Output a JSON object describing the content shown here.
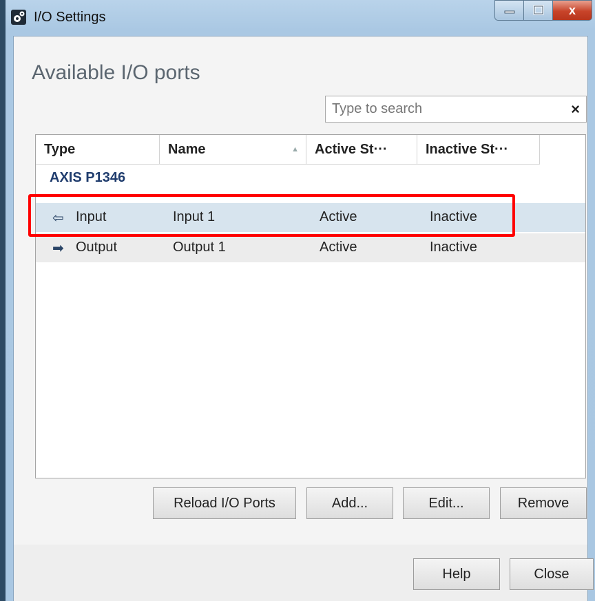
{
  "window": {
    "title": "I/O Settings"
  },
  "dialog": {
    "heading": "Available I/O ports"
  },
  "search": {
    "placeholder": "Type to search",
    "clear_icon": "×"
  },
  "table": {
    "columns": [
      "Type",
      "Name",
      "Active St···",
      "Inactive St···"
    ],
    "sorted_column": "Name",
    "group": "AXIS P1346",
    "rows": [
      {
        "icon": "input-arrow-icon",
        "icon_glyph": "⇦",
        "type": "Input",
        "name": "Input 1",
        "active": "Active",
        "inactive": "Inactive",
        "selected": true
      },
      {
        "icon": "output-arrow-icon",
        "icon_glyph": "➡",
        "type": "Output",
        "name": "Output 1",
        "active": "Active",
        "inactive": "Inactive",
        "selected": false
      }
    ]
  },
  "buttons": {
    "reload": "Reload I/O Ports",
    "add": "Add...",
    "edit": "Edit...",
    "remove": "Remove"
  },
  "footer": {
    "help": "Help",
    "close": "Close"
  },
  "caption": {
    "close_glyph": "x"
  },
  "colors": {
    "highlight": "#ff0000",
    "group_text": "#1f3c6d",
    "selected_row": "#d7e4ee"
  }
}
